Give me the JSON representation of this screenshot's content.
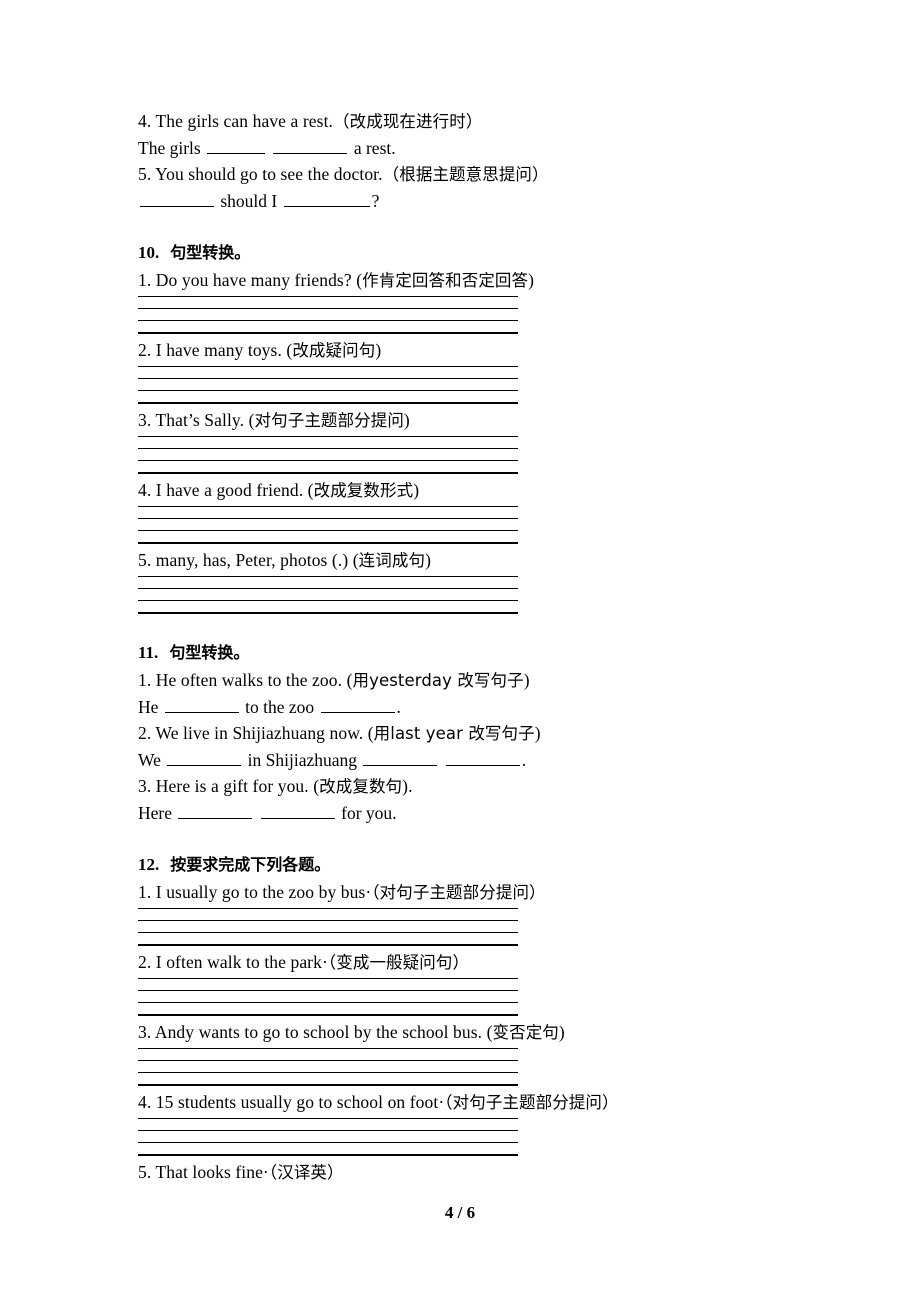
{
  "document": {
    "page_label": "4 / 6"
  },
  "carryover": {
    "items": [
      {
        "question": "4. The girls can have a rest.",
        "instruction": "（改成现在进行时）",
        "answer_prefix": "The girls",
        "answer_suffix": "a rest.",
        "blanks": 2
      },
      {
        "question": "5. You should go to see the doctor.",
        "instruction": "（根据主题意思提问）",
        "answer_prefix": "",
        "answer_mid": "should I",
        "answer_suffix": "?",
        "blanks": 2
      }
    ]
  },
  "sections": [
    {
      "number": "10.",
      "title": "句型转换。",
      "answer_style": "rules",
      "items": [
        {
          "text": "1. Do you have many friends? (",
          "cn": "作肯定回答和否定回答",
          "tail": ")"
        },
        {
          "text": "2. I have many toys. (",
          "cn": "改成疑问句",
          "tail": ")"
        },
        {
          "text": "3. That’s Sally. (",
          "cn": "对句子主题部分提问",
          "tail": ")"
        },
        {
          "text": "4. I have a good friend. (",
          "cn": "改成复数形式",
          "tail": ")"
        },
        {
          "text": "5. many, has, Peter, photos (.) (",
          "cn": "连词成句",
          "tail": ")"
        }
      ]
    },
    {
      "number": "11.",
      "title": "句型转换。",
      "answer_style": "blanks",
      "items": [
        {
          "text": "1. He often walks to the zoo. (",
          "cn": "用yesterday 改写句子",
          "tail": ")",
          "answer_prefix": "He",
          "answer_mid": "to the zoo",
          "answer_suffix": ".",
          "blanks": 2
        },
        {
          "text": "2. We live in Shijiazhuang now. (",
          "cn": "用last year 改写句子",
          "tail": ")",
          "answer_prefix": "We",
          "answer_mid": "in Shijiazhuang",
          "answer_suffix": ".",
          "blanks": 3
        },
        {
          "text": "3. Here is a gift for you. (",
          "cn": "改成复数句",
          "tail": ").",
          "answer_prefix": "Here",
          "answer_mid": "",
          "answer_suffix": "for you.",
          "blanks": 2
        }
      ]
    },
    {
      "number": "12.",
      "title": "按要求完成下列各题。",
      "answer_style": "rules",
      "items": [
        {
          "text": "1. I usually go to the zoo by bus·",
          "cn": "（对句子主题部分提问）",
          "tail": ""
        },
        {
          "text": "2. I often walk to the park·",
          "cn": "（变成一般疑问句）",
          "tail": ""
        },
        {
          "text": "3. Andy wants to go to school by the school bus. (",
          "cn": "变否定句",
          "tail": ")"
        },
        {
          "text": "4. 15 students usually go to school on foot·",
          "cn": "（对句子主题部分提问）",
          "tail": ""
        },
        {
          "text": "5. That looks fine·",
          "cn": "（汉译英）",
          "tail": ""
        }
      ]
    }
  ]
}
